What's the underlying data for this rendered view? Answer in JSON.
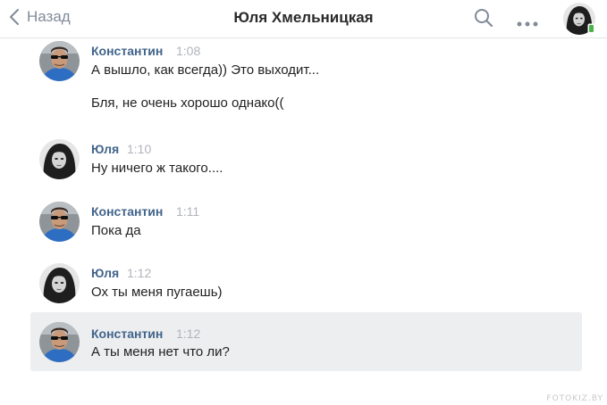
{
  "header": {
    "back_label": "Назад",
    "title": "Юля Хмельницкая",
    "icons": [
      "chevron-left-icon",
      "search-icon",
      "more-icon"
    ]
  },
  "messages": [
    {
      "author": "Константин",
      "time": "1:08",
      "avatar": "konstantin",
      "lines": [
        "А вышло, как всегда)) Это выходит...",
        "Бля, не очень хорошо однако(("
      ]
    },
    {
      "author": "Юля",
      "time": "1:10",
      "avatar": "yulia",
      "lines": [
        "Ну ничего ж такого...."
      ]
    },
    {
      "author": "Константин",
      "time": "1:11",
      "avatar": "konstantin",
      "lines": [
        "Пока да"
      ]
    },
    {
      "author": "Юля",
      "time": "1:12",
      "avatar": "yulia",
      "lines": [
        "Ох ты меня пугаешь)"
      ]
    },
    {
      "author": "Константин",
      "time": "1:12",
      "avatar": "konstantin",
      "lines": [
        "А ты меня нет что ли?"
      ],
      "highlighted": true
    }
  ],
  "colors": {
    "author": "#42648b",
    "time": "#b1b4ba",
    "highlight": "#edeef0",
    "online": "#4bb34b"
  },
  "watermark": "FOTOKIZ.BY"
}
